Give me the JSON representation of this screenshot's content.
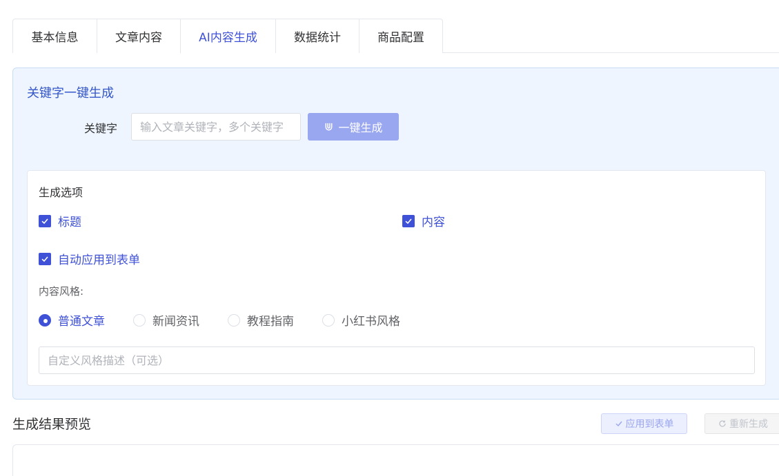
{
  "tabs": [
    {
      "label": "基本信息",
      "active": false
    },
    {
      "label": "文章内容",
      "active": false
    },
    {
      "label": "AI内容生成",
      "active": true
    },
    {
      "label": "数据统计",
      "active": false
    },
    {
      "label": "商品配置",
      "active": false
    }
  ],
  "keyword_panel": {
    "title": "关键字一键生成",
    "keyword_label": "关键字",
    "keyword_placeholder": "输入文章关键字，多个关键字",
    "keyword_value": "",
    "generate_button": "一键生成",
    "generate_icon": "magnet-icon"
  },
  "options": {
    "title": "生成选项",
    "checkboxes": [
      {
        "label": "标题",
        "checked": true
      },
      {
        "label": "内容",
        "checked": true
      },
      {
        "label": "自动应用到表单",
        "checked": true
      }
    ],
    "style_label": "内容风格:",
    "styles": [
      {
        "label": "普通文章",
        "selected": true
      },
      {
        "label": "新闻资讯",
        "selected": false
      },
      {
        "label": "教程指南",
        "selected": false
      },
      {
        "label": "小红书风格",
        "selected": false
      }
    ],
    "custom_style_placeholder": "自定义风格描述（可选）",
    "custom_style_value": ""
  },
  "preview": {
    "title": "生成结果预览",
    "apply_button": "应用到表单",
    "regenerate_button": "重新生成"
  },
  "colors": {
    "accent": "#3f51d6",
    "panel_bg": "#eef5fe",
    "generate_button_bg": "#99a6f0"
  }
}
